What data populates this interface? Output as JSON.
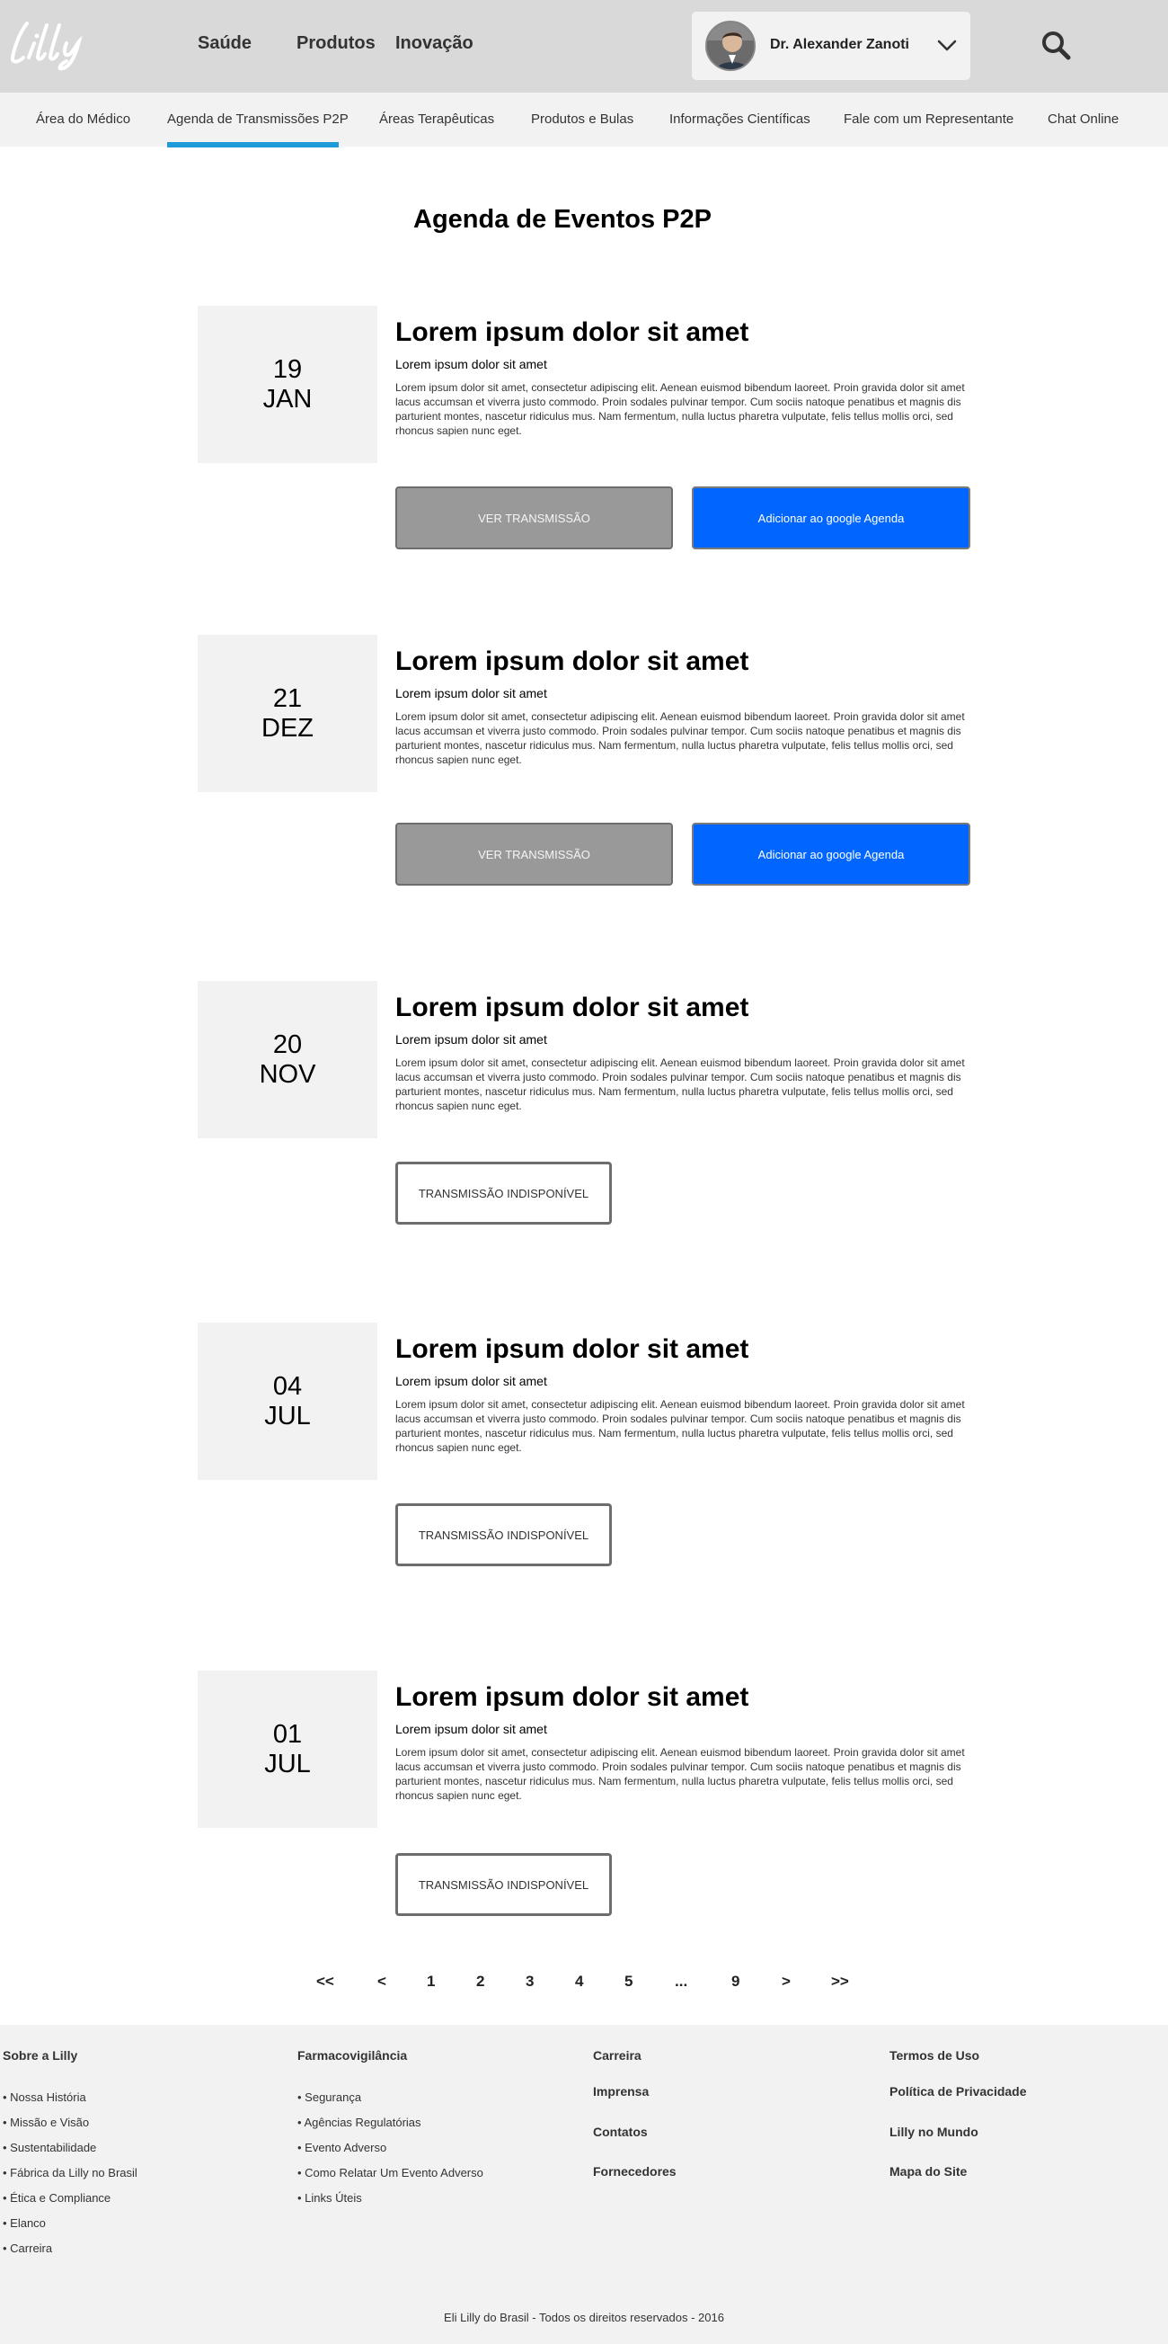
{
  "header": {
    "nav": [
      "Saúde",
      "Produtos",
      "Inovação"
    ],
    "user_name": "Dr. Alexander Zanoti"
  },
  "subnav": [
    "Área do Médico",
    "Agenda de Transmissões P2P",
    "Áreas Terapêuticas",
    "Produtos e Bulas",
    "Informações Científicas",
    "Fale com um Representante",
    "Chat Online"
  ],
  "page_title": "Agenda de Eventos P2P",
  "events": [
    {
      "day": "19",
      "month": "JAN",
      "title": "Lorem ipsum dolor sit amet",
      "subtitle": "Lorem ipsum dolor sit amet",
      "description": "Lorem ipsum dolor sit amet, consectetur adipiscing elit. Aenean euismod bibendum laoreet. Proin gravida dolor sit amet lacus accumsan et viverra justo commodo. Proin sodales pulvinar tempor. Cum sociis natoque penatibus et magnis dis parturient montes, nascetur ridiculus mus. Nam fermentum, nulla luctus pharetra vulputate, felis tellus mollis orci, sed rhoncus sapien nunc eget.",
      "btn_watch": "VER TRANSMISSÃO",
      "btn_calendar": "Adicionar ao google Agenda"
    },
    {
      "day": "21",
      "month": "DEZ",
      "title": "Lorem ipsum dolor sit amet",
      "subtitle": "Lorem ipsum dolor sit amet",
      "description": "Lorem ipsum dolor sit amet, consectetur adipiscing elit. Aenean euismod bibendum laoreet. Proin gravida dolor sit amet lacus accumsan et viverra justo commodo. Proin sodales pulvinar tempor. Cum sociis natoque penatibus et magnis dis parturient montes, nascetur ridiculus mus. Nam fermentum, nulla luctus pharetra vulputate, felis tellus mollis orci, sed rhoncus sapien nunc eget.",
      "btn_watch": "VER TRANSMISSÃO",
      "btn_calendar": "Adicionar ao google Agenda"
    },
    {
      "day": "20",
      "month": "NOV",
      "title": "Lorem ipsum dolor sit amet",
      "subtitle": "Lorem ipsum dolor sit amet",
      "description": "Lorem ipsum dolor sit amet, consectetur adipiscing elit. Aenean euismod bibendum laoreet. Proin gravida dolor sit amet lacus accumsan et viverra justo commodo. Proin sodales pulvinar tempor. Cum sociis natoque penatibus et magnis dis parturient montes, nascetur ridiculus mus. Nam fermentum, nulla luctus pharetra vulputate, felis tellus mollis orci, sed rhoncus sapien nunc eget.",
      "btn_unavailable": "TRANSMISSÃO INDISPONÍVEL"
    },
    {
      "day": "04",
      "month": "JUL",
      "title": "Lorem ipsum dolor sit amet",
      "subtitle": "Lorem ipsum dolor sit amet",
      "description": "Lorem ipsum dolor sit amet, consectetur adipiscing elit. Aenean euismod bibendum laoreet. Proin gravida dolor sit amet lacus accumsan et viverra justo commodo. Proin sodales pulvinar tempor. Cum sociis natoque penatibus et magnis dis parturient montes, nascetur ridiculus mus. Nam fermentum, nulla luctus pharetra vulputate, felis tellus mollis orci, sed rhoncus sapien nunc eget.",
      "btn_unavailable": "TRANSMISSÃO INDISPONÍVEL"
    },
    {
      "day": "01",
      "month": "JUL",
      "title": "Lorem ipsum dolor sit amet",
      "subtitle": "Lorem ipsum dolor sit amet",
      "description": "Lorem ipsum dolor sit amet, consectetur adipiscing elit. Aenean euismod bibendum laoreet. Proin gravida dolor sit amet lacus accumsan et viverra justo commodo. Proin sodales pulvinar tempor. Cum sociis natoque penatibus et magnis dis parturient montes, nascetur ridiculus mus. Nam fermentum, nulla luctus pharetra vulputate, felis tellus mollis orci, sed rhoncus sapien nunc eget.",
      "btn_unavailable": "TRANSMISSÃO INDISPONÍVEL"
    }
  ],
  "pagination": [
    "<<",
    "<",
    "1",
    "2",
    "3",
    "4",
    "5",
    "...",
    "9",
    ">",
    ">>"
  ],
  "footer": {
    "col1_title": "Sobre a Lilly",
    "col1_links": [
      "• Nossa História",
      "• Missão e Visão",
      "• Sustentabilidade",
      "• Fábrica da Lilly no Brasil",
      "• Ética e Compliance",
      "• Elanco",
      "• Carreira"
    ],
    "col2_title": "Farmacovigilância",
    "col2_links": [
      "• Segurança",
      "• Agências Regulatórias",
      "• Evento Adverso",
      "• Como Relatar Um Evento Adverso",
      "• Links Úteis"
    ],
    "col3_links": [
      "Carreira",
      "Imprensa",
      "Contatos",
      "Fornecedores"
    ],
    "col4_links": [
      "Termos de Uso",
      "Política de Privacidade",
      "Lilly no Mundo",
      "Mapa do Site"
    ],
    "copyright": "Eli Lilly do Brasil - Todos os direitos reservados - 2016"
  },
  "colors": {
    "header_bg": "#d9d9d9",
    "subnav_bg": "#f2f2f2",
    "active_tab": "#1e9bd7",
    "calendar_button": "#0066ff",
    "watch_button": "#999999"
  },
  "icons": [
    "lilly-logo",
    "avatar",
    "chevron-down-icon",
    "search-icon"
  ]
}
